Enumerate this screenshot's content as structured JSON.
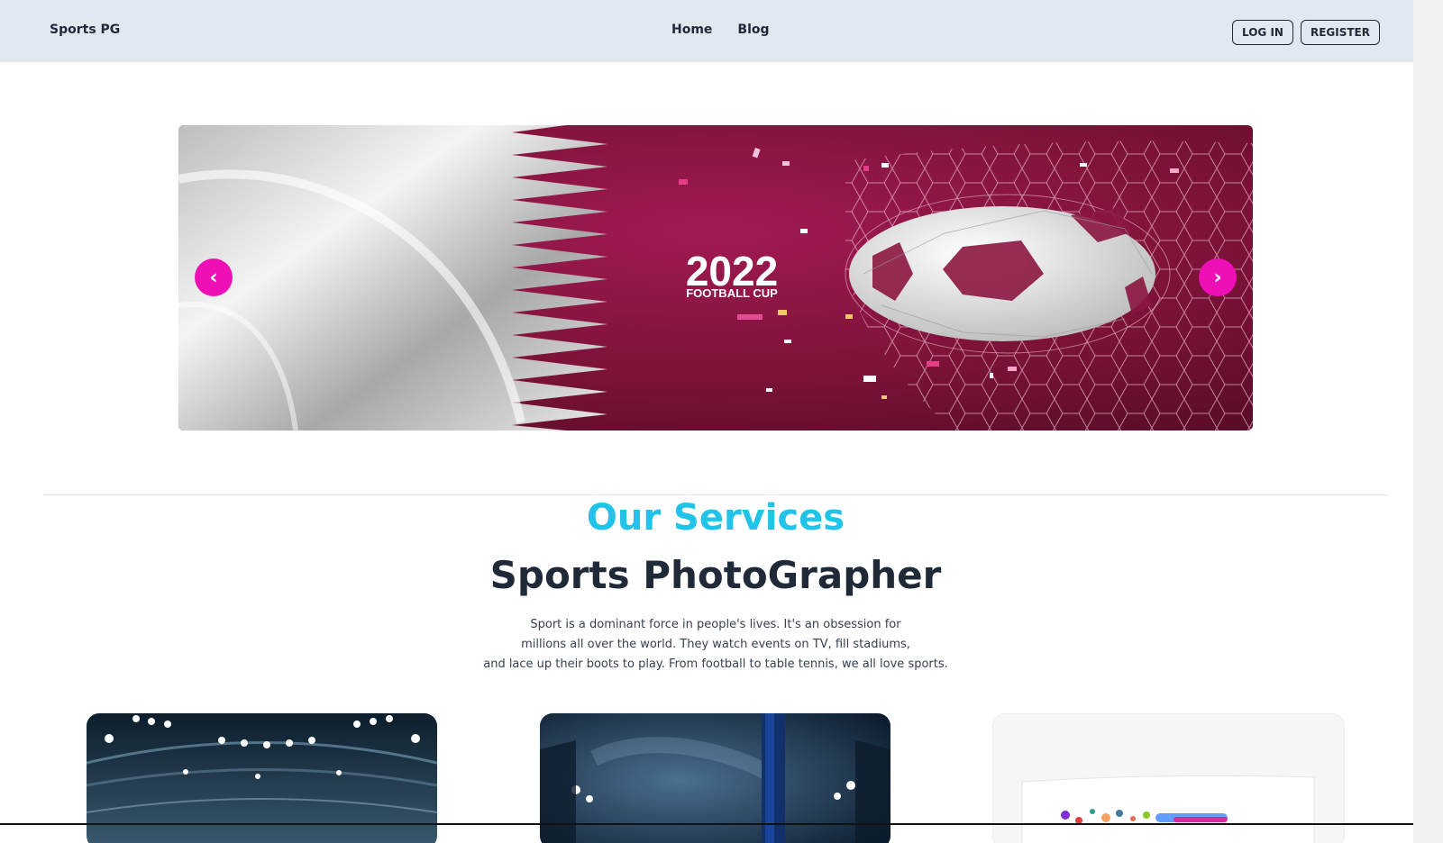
{
  "header": {
    "brand": "Sports PG",
    "nav": [
      {
        "label": "Home"
      },
      {
        "label": "Blog"
      }
    ],
    "login_label": "LOG IN",
    "register_label": "REGISTER"
  },
  "carousel": {
    "slide_title": "2022",
    "slide_subtitle": "FOOTBALL CUP",
    "prev_icon": "‹",
    "next_icon": "›"
  },
  "services": {
    "heading": "Our Services",
    "title": "Sports PhotoGrapher",
    "description_lines": [
      "Sport is a dominant force in people's lives. It's an obsession for",
      "millions all over the world. They watch events on TV, fill stadiums,",
      "and lace up their boots to play. From football to table tennis, we all love sports."
    ]
  },
  "colors": {
    "accent_pink": "#ee0fb6",
    "heading_cyan": "#22c3e8",
    "header_bg": "#e2e8f0"
  }
}
